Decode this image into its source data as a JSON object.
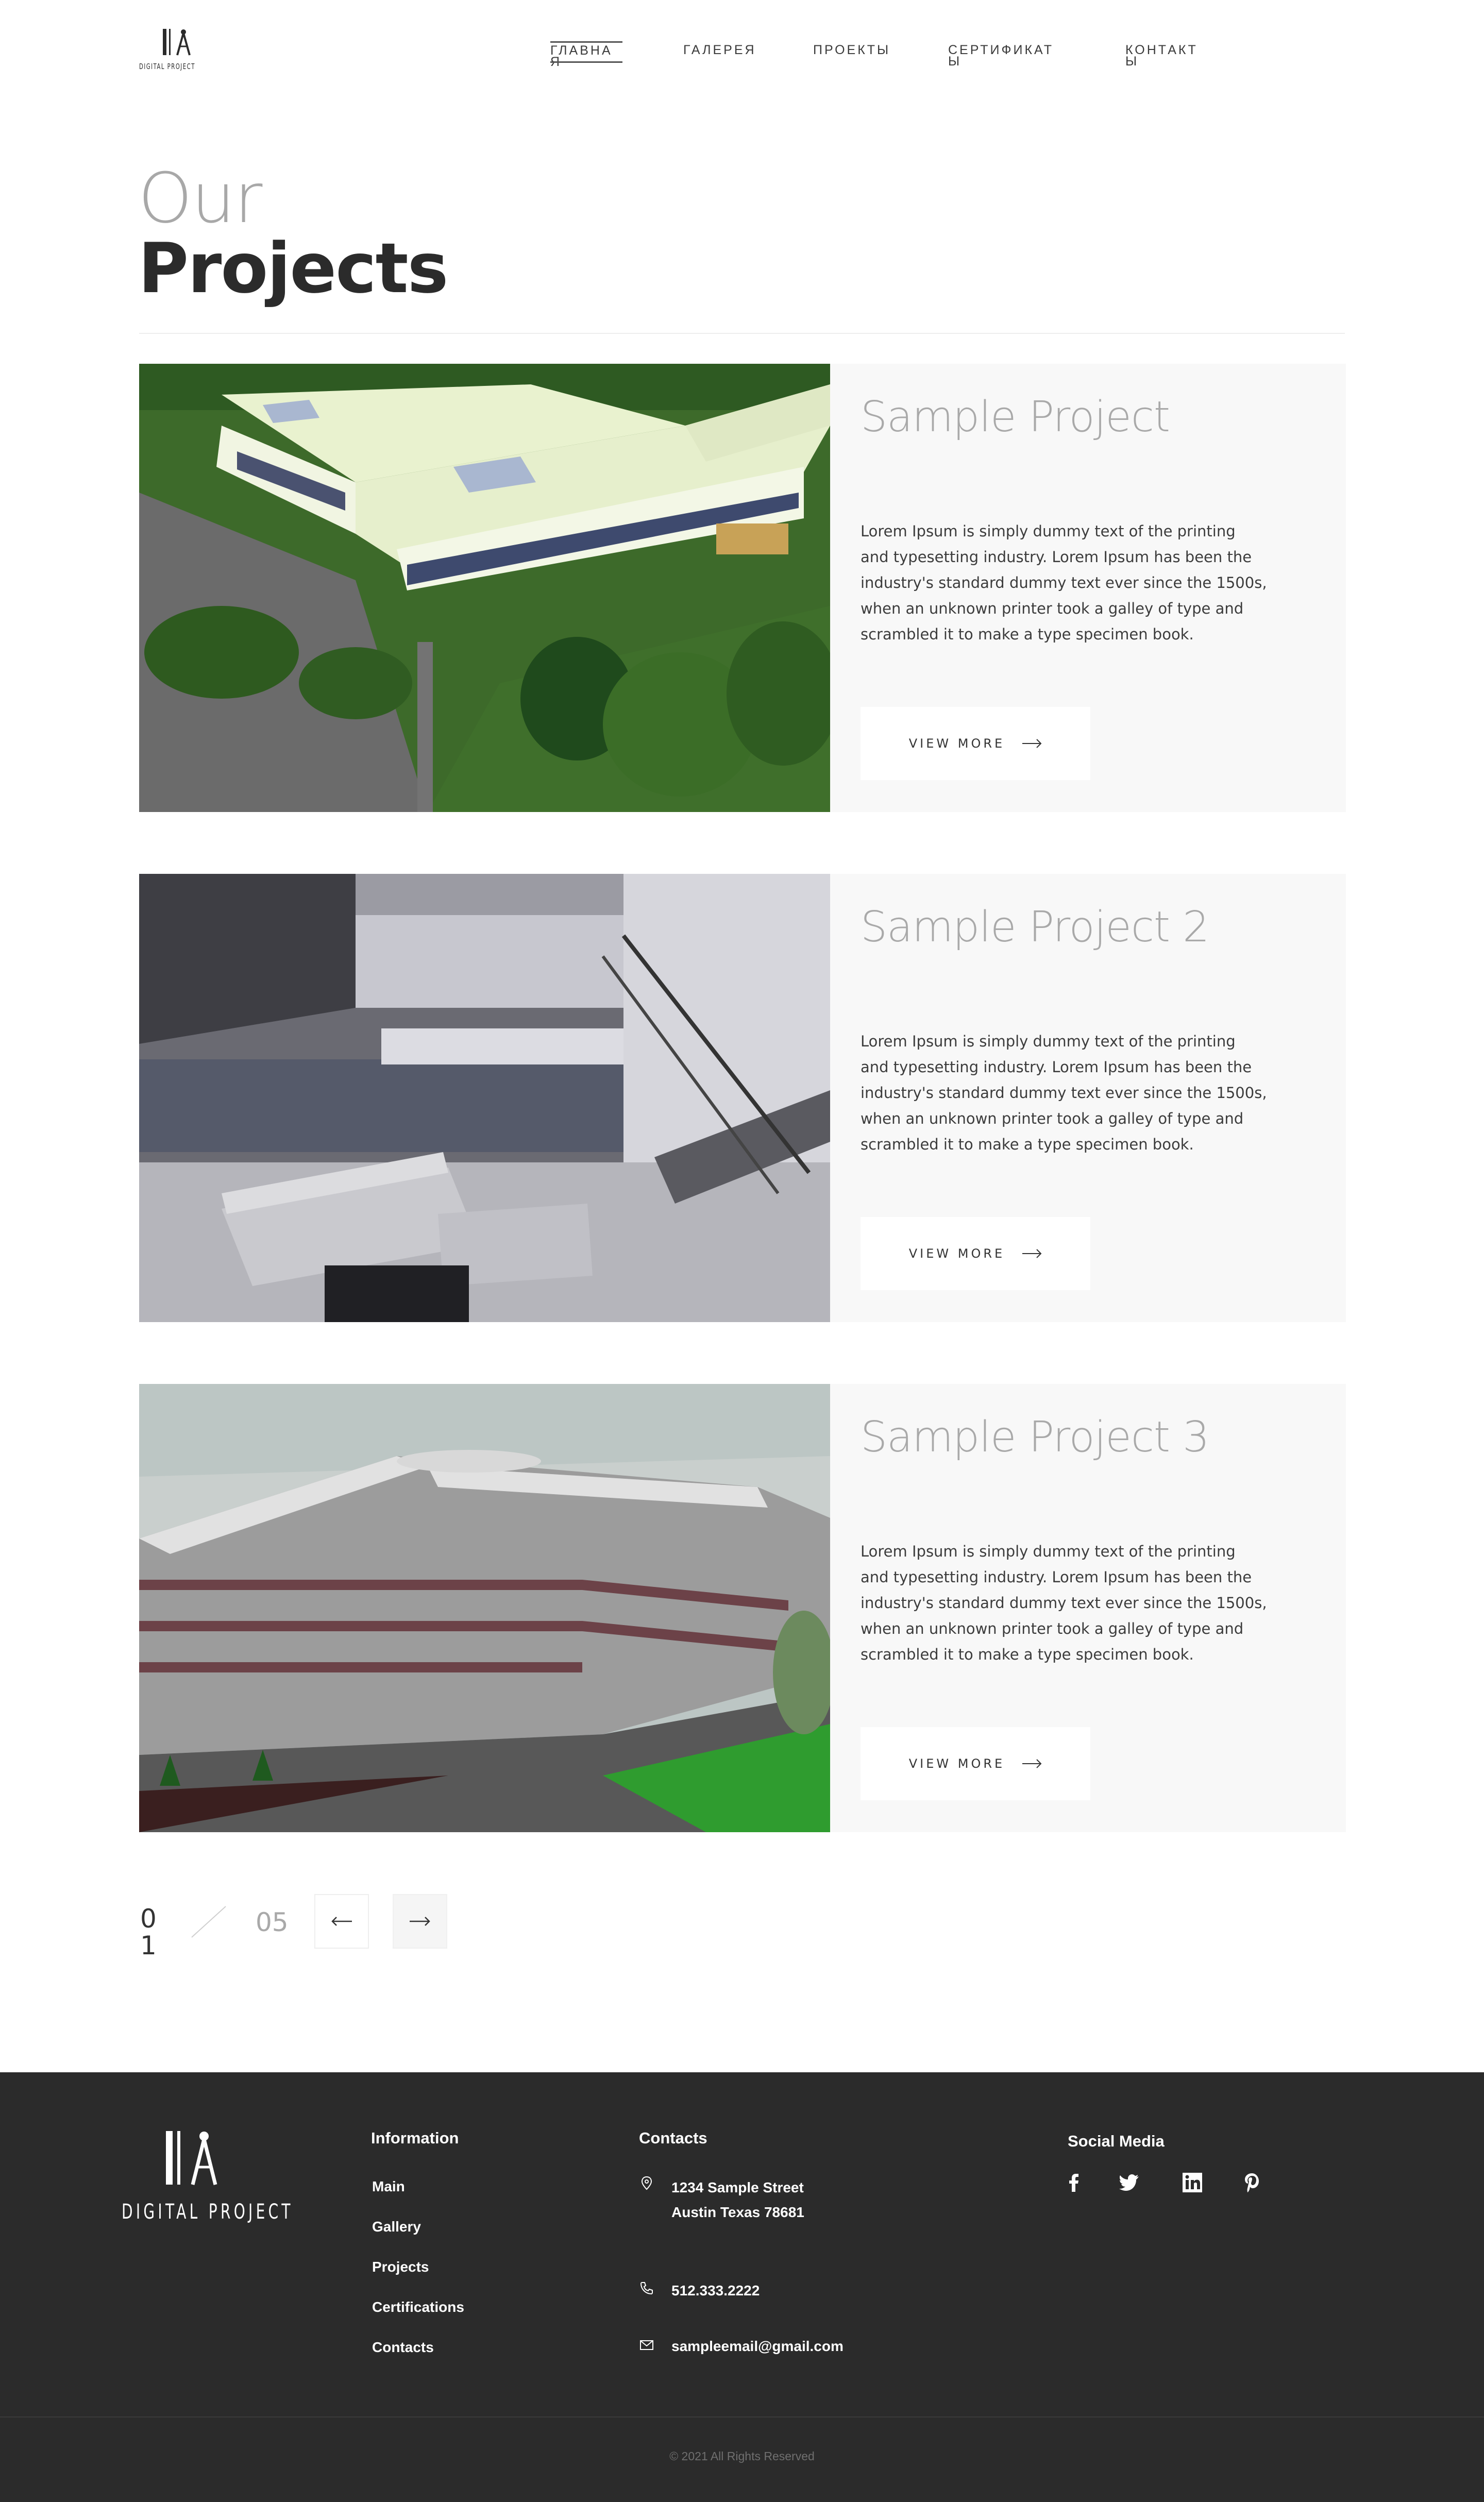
{
  "brand": {
    "name": "DIGITAL PROJECT"
  },
  "nav": {
    "items": [
      {
        "label": "ГЛАВНАЯ",
        "active": true
      },
      {
        "label": "ГАЛЕРЕЯ",
        "active": false
      },
      {
        "label": "ПРОЕКТЫ",
        "active": false
      },
      {
        "label": "СЕРТИФИКАТЫ",
        "active": false
      },
      {
        "label": "КОНТАКТЫ",
        "active": false
      }
    ]
  },
  "hero": {
    "line1": "Our",
    "line2": "Projects"
  },
  "projects": [
    {
      "title": "Sample Project",
      "description": "Lorem Ipsum is simply dummy text of the printing and typesetting industry. Lorem Ipsum has been the industry's standard dummy text ever since the 1500s, when an unknown printer took a galley of type and scrambled it to make a type specimen book.",
      "button_label": "VIEW MORE",
      "image": "aerial-white-building-render"
    },
    {
      "title": "Sample Project 2",
      "description": "Lorem Ipsum is simply dummy text of the printing and typesetting industry. Lorem Ipsum has been the industry's standard dummy text ever since the 1500s, when an unknown printer took a galley of type and scrambled it to make a type specimen book.",
      "button_label": "VIEW MORE",
      "image": "interior-lounge-staircase-render"
    },
    {
      "title": "Sample Project 3",
      "description": "Lorem Ipsum is simply dummy text of the printing and typesetting industry. Lorem Ipsum has been the industry's standard dummy text ever since the 1500s, when an unknown printer took a galley of type and scrambled it to make a type specimen book.",
      "button_label": "VIEW MORE",
      "image": "modern-office-building-render"
    }
  ],
  "pagination": {
    "current": "01",
    "total": "05"
  },
  "footer": {
    "information": {
      "heading": "Information",
      "links": [
        "Main",
        "Gallery",
        "Projects",
        "Certifications",
        "Contacts"
      ]
    },
    "contacts": {
      "heading": "Contacts",
      "address_line1": "1234 Sample Street",
      "address_line2": "Austin Texas 78681",
      "phone": "512.333.2222",
      "email": "sampleemail@gmail.com"
    },
    "social": {
      "heading": "Social Media",
      "icons": [
        "facebook-icon",
        "twitter-icon",
        "linkedin-icon",
        "pinterest-icon"
      ]
    },
    "copyright": "© 2021 All Rights Reserved"
  },
  "colors": {
    "footer_bg": "#2b2b2b",
    "card_bg": "#f8f8f8",
    "muted_title": "#a9a9a9",
    "dark_text": "#2b2b2b"
  }
}
